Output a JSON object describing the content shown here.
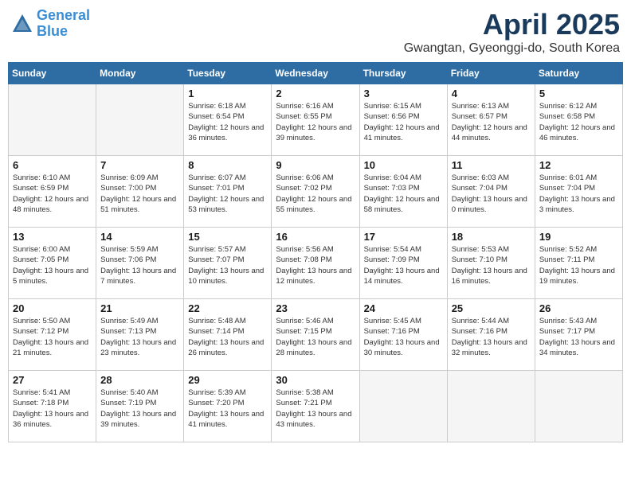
{
  "header": {
    "logo_line1": "General",
    "logo_line2": "Blue",
    "month_title": "April 2025",
    "location": "Gwangtan, Gyeonggi-do, South Korea"
  },
  "weekdays": [
    "Sunday",
    "Monday",
    "Tuesday",
    "Wednesday",
    "Thursday",
    "Friday",
    "Saturday"
  ],
  "weeks": [
    [
      {
        "day": "",
        "empty": true
      },
      {
        "day": "",
        "empty": true
      },
      {
        "day": "1",
        "sunrise": "Sunrise: 6:18 AM",
        "sunset": "Sunset: 6:54 PM",
        "daylight": "Daylight: 12 hours and 36 minutes."
      },
      {
        "day": "2",
        "sunrise": "Sunrise: 6:16 AM",
        "sunset": "Sunset: 6:55 PM",
        "daylight": "Daylight: 12 hours and 39 minutes."
      },
      {
        "day": "3",
        "sunrise": "Sunrise: 6:15 AM",
        "sunset": "Sunset: 6:56 PM",
        "daylight": "Daylight: 12 hours and 41 minutes."
      },
      {
        "day": "4",
        "sunrise": "Sunrise: 6:13 AM",
        "sunset": "Sunset: 6:57 PM",
        "daylight": "Daylight: 12 hours and 44 minutes."
      },
      {
        "day": "5",
        "sunrise": "Sunrise: 6:12 AM",
        "sunset": "Sunset: 6:58 PM",
        "daylight": "Daylight: 12 hours and 46 minutes."
      }
    ],
    [
      {
        "day": "6",
        "sunrise": "Sunrise: 6:10 AM",
        "sunset": "Sunset: 6:59 PM",
        "daylight": "Daylight: 12 hours and 48 minutes."
      },
      {
        "day": "7",
        "sunrise": "Sunrise: 6:09 AM",
        "sunset": "Sunset: 7:00 PM",
        "daylight": "Daylight: 12 hours and 51 minutes."
      },
      {
        "day": "8",
        "sunrise": "Sunrise: 6:07 AM",
        "sunset": "Sunset: 7:01 PM",
        "daylight": "Daylight: 12 hours and 53 minutes."
      },
      {
        "day": "9",
        "sunrise": "Sunrise: 6:06 AM",
        "sunset": "Sunset: 7:02 PM",
        "daylight": "Daylight: 12 hours and 55 minutes."
      },
      {
        "day": "10",
        "sunrise": "Sunrise: 6:04 AM",
        "sunset": "Sunset: 7:03 PM",
        "daylight": "Daylight: 12 hours and 58 minutes."
      },
      {
        "day": "11",
        "sunrise": "Sunrise: 6:03 AM",
        "sunset": "Sunset: 7:04 PM",
        "daylight": "Daylight: 13 hours and 0 minutes."
      },
      {
        "day": "12",
        "sunrise": "Sunrise: 6:01 AM",
        "sunset": "Sunset: 7:04 PM",
        "daylight": "Daylight: 13 hours and 3 minutes."
      }
    ],
    [
      {
        "day": "13",
        "sunrise": "Sunrise: 6:00 AM",
        "sunset": "Sunset: 7:05 PM",
        "daylight": "Daylight: 13 hours and 5 minutes."
      },
      {
        "day": "14",
        "sunrise": "Sunrise: 5:59 AM",
        "sunset": "Sunset: 7:06 PM",
        "daylight": "Daylight: 13 hours and 7 minutes."
      },
      {
        "day": "15",
        "sunrise": "Sunrise: 5:57 AM",
        "sunset": "Sunset: 7:07 PM",
        "daylight": "Daylight: 13 hours and 10 minutes."
      },
      {
        "day": "16",
        "sunrise": "Sunrise: 5:56 AM",
        "sunset": "Sunset: 7:08 PM",
        "daylight": "Daylight: 13 hours and 12 minutes."
      },
      {
        "day": "17",
        "sunrise": "Sunrise: 5:54 AM",
        "sunset": "Sunset: 7:09 PM",
        "daylight": "Daylight: 13 hours and 14 minutes."
      },
      {
        "day": "18",
        "sunrise": "Sunrise: 5:53 AM",
        "sunset": "Sunset: 7:10 PM",
        "daylight": "Daylight: 13 hours and 16 minutes."
      },
      {
        "day": "19",
        "sunrise": "Sunrise: 5:52 AM",
        "sunset": "Sunset: 7:11 PM",
        "daylight": "Daylight: 13 hours and 19 minutes."
      }
    ],
    [
      {
        "day": "20",
        "sunrise": "Sunrise: 5:50 AM",
        "sunset": "Sunset: 7:12 PM",
        "daylight": "Daylight: 13 hours and 21 minutes."
      },
      {
        "day": "21",
        "sunrise": "Sunrise: 5:49 AM",
        "sunset": "Sunset: 7:13 PM",
        "daylight": "Daylight: 13 hours and 23 minutes."
      },
      {
        "day": "22",
        "sunrise": "Sunrise: 5:48 AM",
        "sunset": "Sunset: 7:14 PM",
        "daylight": "Daylight: 13 hours and 26 minutes."
      },
      {
        "day": "23",
        "sunrise": "Sunrise: 5:46 AM",
        "sunset": "Sunset: 7:15 PM",
        "daylight": "Daylight: 13 hours and 28 minutes."
      },
      {
        "day": "24",
        "sunrise": "Sunrise: 5:45 AM",
        "sunset": "Sunset: 7:16 PM",
        "daylight": "Daylight: 13 hours and 30 minutes."
      },
      {
        "day": "25",
        "sunrise": "Sunrise: 5:44 AM",
        "sunset": "Sunset: 7:16 PM",
        "daylight": "Daylight: 13 hours and 32 minutes."
      },
      {
        "day": "26",
        "sunrise": "Sunrise: 5:43 AM",
        "sunset": "Sunset: 7:17 PM",
        "daylight": "Daylight: 13 hours and 34 minutes."
      }
    ],
    [
      {
        "day": "27",
        "sunrise": "Sunrise: 5:41 AM",
        "sunset": "Sunset: 7:18 PM",
        "daylight": "Daylight: 13 hours and 36 minutes."
      },
      {
        "day": "28",
        "sunrise": "Sunrise: 5:40 AM",
        "sunset": "Sunset: 7:19 PM",
        "daylight": "Daylight: 13 hours and 39 minutes."
      },
      {
        "day": "29",
        "sunrise": "Sunrise: 5:39 AM",
        "sunset": "Sunset: 7:20 PM",
        "daylight": "Daylight: 13 hours and 41 minutes."
      },
      {
        "day": "30",
        "sunrise": "Sunrise: 5:38 AM",
        "sunset": "Sunset: 7:21 PM",
        "daylight": "Daylight: 13 hours and 43 minutes."
      },
      {
        "day": "",
        "empty": true
      },
      {
        "day": "",
        "empty": true
      },
      {
        "day": "",
        "empty": true
      }
    ]
  ]
}
